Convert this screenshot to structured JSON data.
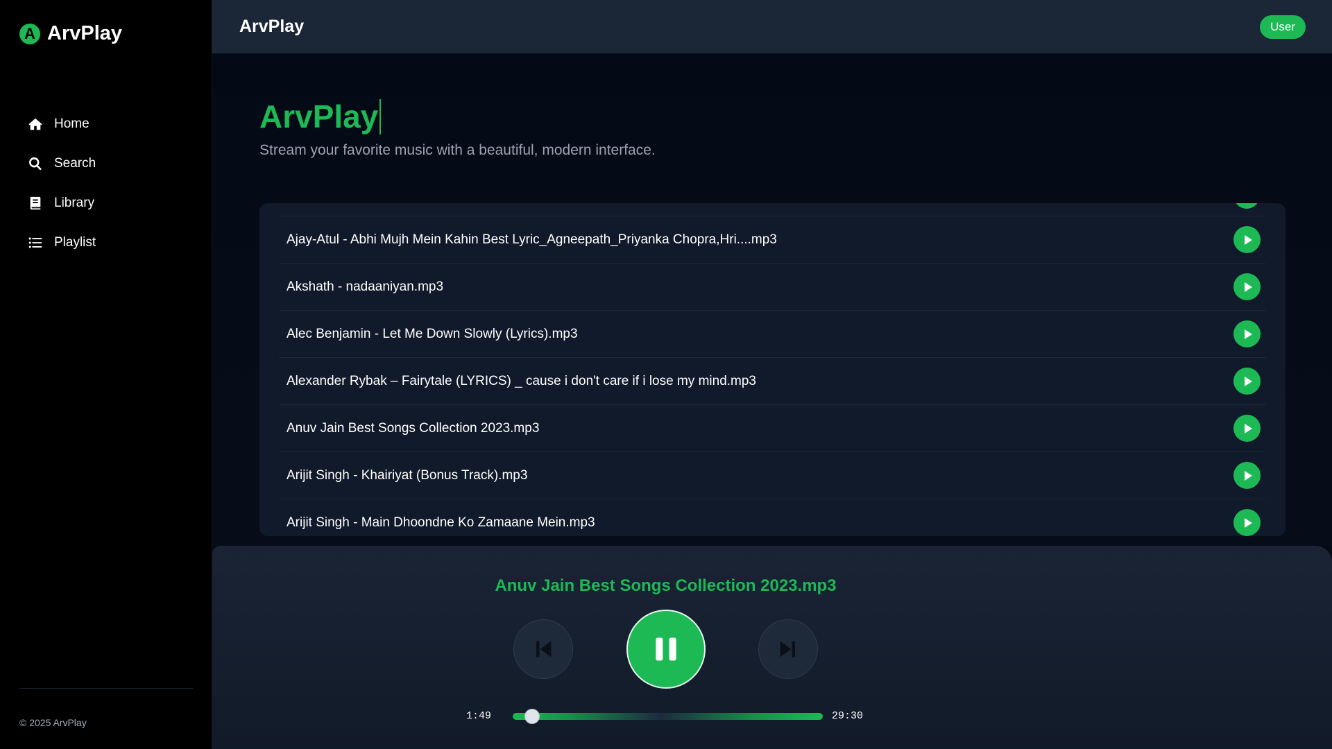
{
  "brand": {
    "logo_letter": "A",
    "name": "ArvPlay"
  },
  "nav": [
    {
      "label": "Home",
      "icon": "home-icon"
    },
    {
      "label": "Search",
      "icon": "search-icon"
    },
    {
      "label": "Library",
      "icon": "book-icon"
    },
    {
      "label": "Playlist",
      "icon": "list-icon"
    }
  ],
  "footer": {
    "copyright": "© 2025 ArvPlay"
  },
  "header": {
    "title": "ArvPlay",
    "user_label": "User"
  },
  "hero": {
    "title": "ArvPlay",
    "subtitle": "Stream your favorite music with a beautiful, modern interface."
  },
  "songs": [
    "Ajay-Atul - Abhi Mujh Mein Kahin Best Lyric_Agneepath_Priyanka Chopra,Hri....mp3",
    "Akshath - nadaaniyan.mp3",
    "Alec Benjamin - Let Me Down Slowly (Lyrics).mp3",
    "Alexander Rybak – Fairytale (LYRICS) _ cause i don't care if i lose my mind.mp3",
    "Anuv Jain Best Songs Collection 2023.mp3",
    "Arijit Singh - Khairiyat (Bonus Track).mp3",
    "Arijit Singh - Main Dhoondne Ko Zamaane Mein.mp3"
  ],
  "player": {
    "now_playing": "Anuv Jain Best Songs Collection 2023.mp3",
    "current_time": "1:49",
    "total_time": "29:30",
    "progress_fraction": 0.0616
  },
  "colors": {
    "accent": "#1db954",
    "sidebar_bg": "#000000",
    "header_bg": "#1b2637"
  }
}
